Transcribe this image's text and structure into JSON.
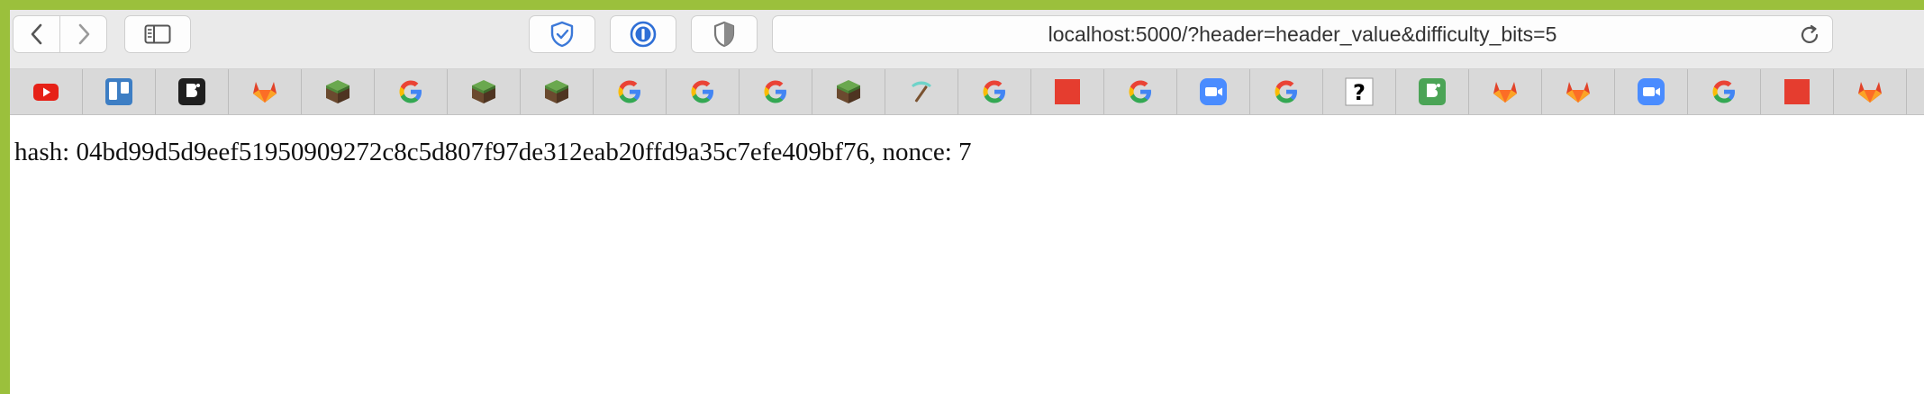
{
  "browser": {
    "url": "localhost:5000/?header=header_value&difficulty_bits=5",
    "toolbar": {
      "back_icon": "chevron-left-icon",
      "forward_icon": "chevron-right-icon",
      "sidebar_icon": "sidebar-icon",
      "extensions": [
        "shield-check-icon",
        "password-manager-icon",
        "privacy-shield-icon"
      ],
      "reload_icon": "reload-icon"
    },
    "favorites": [
      "youtube-icon",
      "trello-icon",
      "bitbucket-icon",
      "gitlab-icon",
      "minecraft-block-icon",
      "google-icon",
      "minecraft-block-icon",
      "minecraft-block-icon",
      "google-icon",
      "google-icon",
      "google-icon",
      "minecraft-block-icon",
      "pickaxe-icon",
      "google-icon",
      "red-square-icon",
      "google-icon",
      "zoom-icon",
      "google-icon",
      "question-mark-icon",
      "bitbucket-green-icon",
      "gitlab-icon",
      "gitlab-icon",
      "zoom-icon",
      "google-icon",
      "red-square-icon",
      "gitlab-icon"
    ]
  },
  "page": {
    "text": "hash: 04bd99d5d9eef51950909272c8c5d807f97de312eab20ffd9a35c7efe409bf76, nonce: 7"
  },
  "colors": {
    "window_frame": "#9bc03c",
    "toolbar_bg": "#eaeaea",
    "favbar_bg": "#d9d9d9"
  }
}
